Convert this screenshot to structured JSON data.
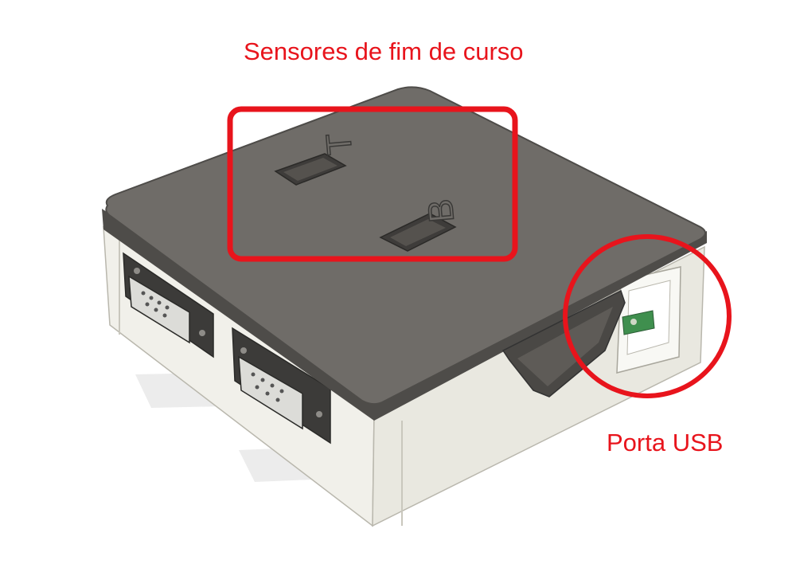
{
  "annotations": {
    "sensors_label": "Sensores de fim de curso",
    "usb_label": "Porta USB"
  },
  "lid_markings": {
    "top_sensor": "T",
    "bottom_sensor": "B"
  },
  "colors": {
    "annotation": "#e8141c",
    "lid": "#6f6c68",
    "lid_edge": "#4e4c49",
    "body": "#ecebe3",
    "body_shade": "#d9d7cd",
    "connector": "#3c3b39",
    "pcb": "#3f8f4e"
  }
}
